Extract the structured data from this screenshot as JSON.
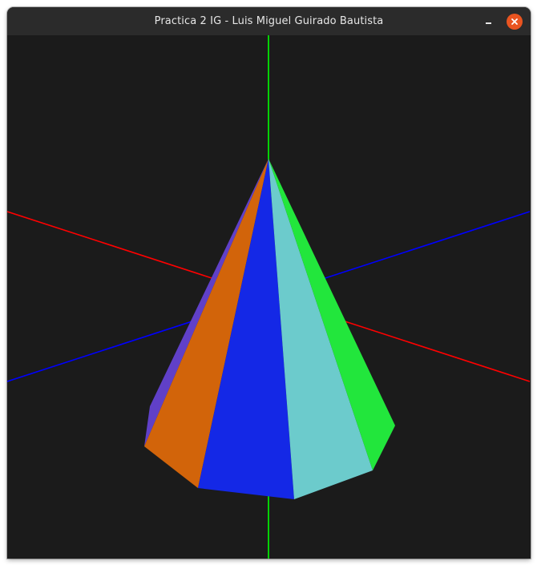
{
  "window": {
    "title": "Practica 2 IG - Luis Miguel Guirado Bautista",
    "buttons": [
      {
        "name": "minimize",
        "icon": "minimize-icon"
      },
      {
        "name": "close",
        "icon": "close-icon",
        "color": "#e95420"
      }
    ]
  },
  "scene": {
    "background": "#1b1b1b",
    "axes": [
      {
        "name": "x-axis",
        "color": "#ff0000"
      },
      {
        "name": "y-axis",
        "color": "#00ff00"
      },
      {
        "name": "z-axis",
        "color": "#0000ff"
      }
    ],
    "cone": {
      "faces": [
        {
          "name": "purple-face",
          "color": "#6040c8"
        },
        {
          "name": "orange-face",
          "color": "#d2640a"
        },
        {
          "name": "blue-face",
          "color": "#1428e6"
        },
        {
          "name": "cyan-face",
          "color": "#6ccbcc"
        },
        {
          "name": "green-face",
          "color": "#22e63c"
        }
      ]
    }
  }
}
